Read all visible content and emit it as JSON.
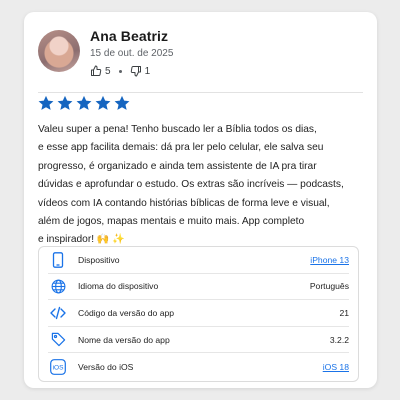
{
  "review": {
    "author": "Ana Beatriz",
    "date": "15 de out. de 2025",
    "likes": "5",
    "dislikes": "1",
    "rating": 5,
    "star_color": "#1565c0",
    "lines": [
      "Valeu super a pena! Tenho buscado ler a Bíblia todos os dias,",
      "e esse app facilita demais: dá pra ler pelo celular, ele salva seu",
      "progresso, é organizado e ainda tem assistente de IA pra tirar",
      "dúvidas e aprofundar o estudo. Os extras são incríveis — podcasts,",
      "vídeos com IA contando histórias bíblicas de forma leve e visual,",
      "além de jogos, mapas mentais e muito mais. App completo",
      "e inspirador! 🙌 ✨"
    ]
  },
  "details": [
    {
      "icon": "phone-icon",
      "label": "Dispositivo",
      "value": "iPhone 13",
      "link": true
    },
    {
      "icon": "globe-icon",
      "label": "Idioma do dispositivo",
      "value": "Português",
      "link": false
    },
    {
      "icon": "code-icon",
      "label": "Código da versão do app",
      "value": "21",
      "link": false
    },
    {
      "icon": "tag-icon",
      "label": "Nome da versão do app",
      "value": "3.2.2",
      "link": false
    },
    {
      "icon": "ios-icon",
      "label": "Versão do iOS",
      "value": "iOS 18",
      "link": true
    }
  ],
  "colors": {
    "accent": "#1a73e8",
    "icon": "#1a73e8"
  }
}
